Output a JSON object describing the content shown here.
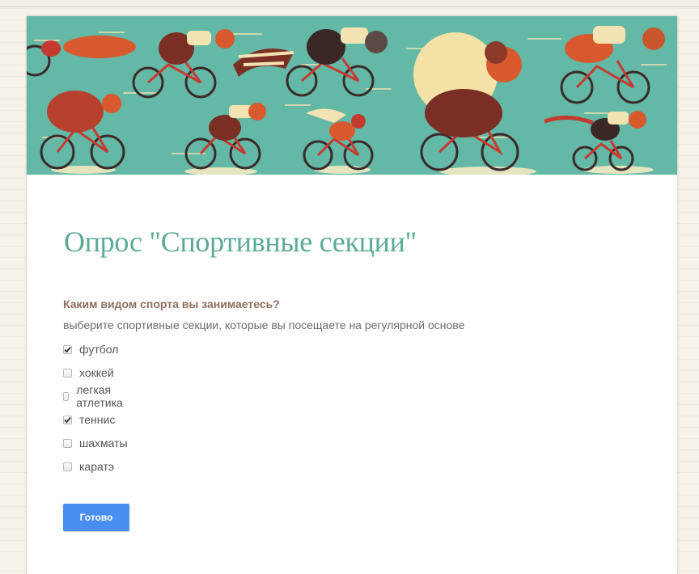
{
  "form": {
    "title": "Опрос \"Спортивные секции\"",
    "question": {
      "title": "Каким видом спорта вы занимаетесь?",
      "help": "выберите спортивные секции, которые вы посещаете на регулярной основе",
      "options": [
        {
          "label": "футбол",
          "checked": true
        },
        {
          "label": "хоккей",
          "checked": false
        },
        {
          "label": "легкая атлетика",
          "checked": false
        },
        {
          "label": "теннис",
          "checked": true
        },
        {
          "label": "шахматы",
          "checked": false
        },
        {
          "label": "каратэ",
          "checked": false
        }
      ]
    },
    "submit_label": "Готово"
  },
  "colors": {
    "banner_background": "#63b8a6",
    "title": "#5aab95",
    "question": "#8f6f5c",
    "submit_button": "#4a8ef2"
  }
}
